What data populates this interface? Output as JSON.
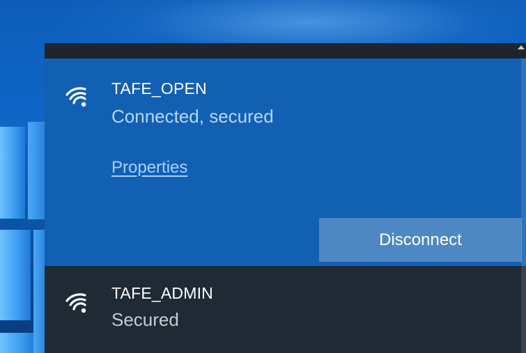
{
  "networks": {
    "connected": {
      "ssid": "TAFE_OPEN",
      "status": "Connected, secured",
      "properties_label": "Properties",
      "disconnect_label": "Disconnect",
      "icon": "wifi-icon"
    },
    "available": [
      {
        "ssid": "TAFE_ADMIN",
        "status": "Secured",
        "icon": "wifi-icon"
      }
    ]
  },
  "colors": {
    "selected_bg": "#1260b3",
    "flyout_bg": "#1f2a35",
    "link": "#a6d0ff",
    "button_bg": "#4d88c4"
  }
}
